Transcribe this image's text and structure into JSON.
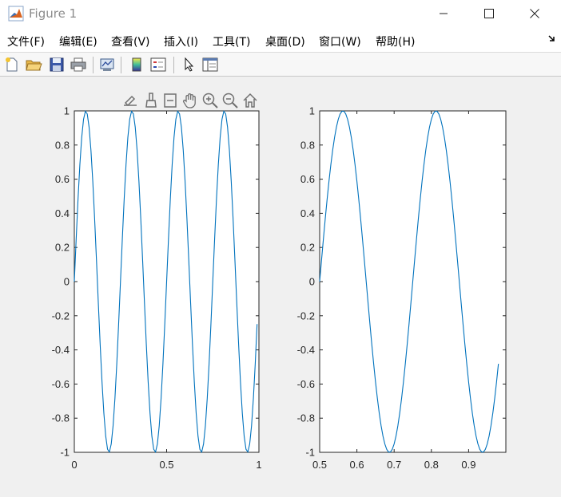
{
  "window": {
    "title": "Figure 1",
    "icon": "matlab-icon",
    "controls": [
      "minimize-icon",
      "maximize-icon",
      "close-icon"
    ]
  },
  "menubar": {
    "items": [
      "文件(F)",
      "编辑(E)",
      "查看(V)",
      "插入(I)",
      "工具(T)",
      "桌面(D)",
      "窗口(W)",
      "帮助(H)"
    ],
    "dock_icon": "dock-arrow-icon"
  },
  "toolbar": {
    "buttons": [
      "new-figure-icon",
      "open-file-icon",
      "save-icon",
      "print-icon",
      "link-plot-icon",
      "colorbar-icon",
      "legend-icon",
      "edit-plot-arrow-icon",
      "property-inspector-icon"
    ]
  },
  "axes_toolbar": {
    "buttons": [
      "export-icon",
      "brush-icon",
      "data-tips-icon",
      "pan-hand-icon",
      "zoom-in-icon",
      "zoom-out-icon",
      "restore-view-home-icon"
    ]
  },
  "colors": {
    "line": "#0072bd",
    "axes_bg": "#ffffff",
    "figure_bg": "#f0f0f0",
    "axis": "#262626"
  },
  "chart_data": [
    {
      "type": "line",
      "function": "y = sin(2*pi*4*x)",
      "x_range": [
        0,
        1
      ],
      "series": [
        {
          "frequency_hz": 4,
          "phase": 0,
          "x_start": 0,
          "x_end": 0.99,
          "x_step": 0.01
        }
      ],
      "xlim": [
        0,
        1
      ],
      "ylim": [
        -1,
        1
      ],
      "xticks": [
        0,
        0.5,
        1
      ],
      "xtick_labels": [
        "0",
        "0.5",
        "1"
      ],
      "yticks": [
        -1,
        -0.8,
        -0.6,
        -0.4,
        -0.2,
        0,
        0.2,
        0.4,
        0.6,
        0.8,
        1
      ],
      "ytick_labels": [
        "-1",
        "-0.8",
        "-0.6",
        "-0.4",
        "-0.2",
        "0",
        "0.2",
        "0.4",
        "0.6",
        "0.8",
        "1"
      ],
      "grid": false,
      "title": "",
      "xlabel": "",
      "ylabel": ""
    },
    {
      "type": "line",
      "function": "y = sin(2*pi*4*x)",
      "series": [
        {
          "frequency_hz": 4,
          "phase": 0,
          "x_start": 0.5,
          "x_end": 0.98,
          "x_step": 0.005
        }
      ],
      "xlim": [
        0.5,
        1.0
      ],
      "ylim": [
        -1,
        1
      ],
      "xticks": [
        0.5,
        0.6,
        0.7,
        0.8,
        0.9
      ],
      "xtick_labels": [
        "0.5",
        "0.6",
        "0.7",
        "0.8",
        "0.9"
      ],
      "yticks": [
        -1,
        -0.8,
        -0.6,
        -0.4,
        -0.2,
        0,
        0.2,
        0.4,
        0.6,
        0.8,
        1
      ],
      "ytick_labels": [
        "-1",
        "-0.8",
        "-0.6",
        "-0.4",
        "-0.2",
        "0",
        "0.2",
        "0.4",
        "0.6",
        "0.8",
        "1"
      ],
      "grid": false,
      "title": "",
      "xlabel": "",
      "ylabel": ""
    }
  ]
}
